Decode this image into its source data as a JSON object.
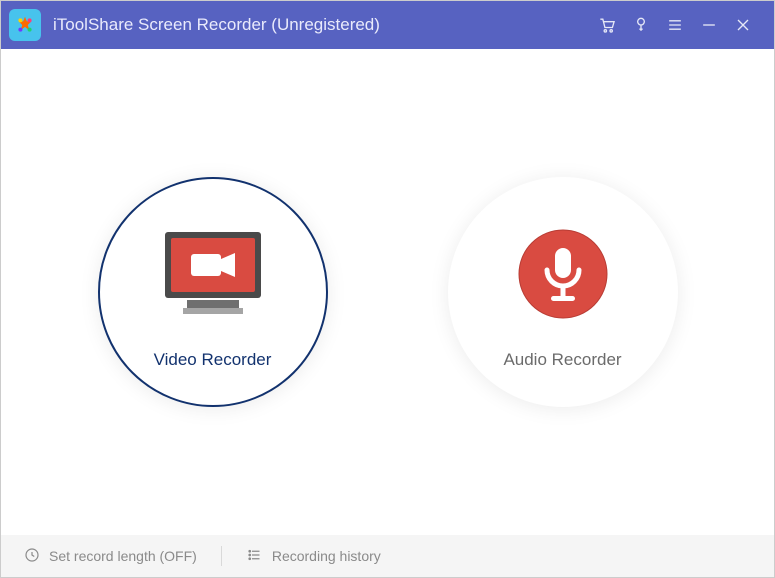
{
  "app": {
    "title": "iToolShare Screen Recorder (Unregistered)"
  },
  "main": {
    "video_label": "Video Recorder",
    "audio_label": "Audio Recorder"
  },
  "footer": {
    "record_length": "Set record length (OFF)",
    "history": "Recording history"
  }
}
